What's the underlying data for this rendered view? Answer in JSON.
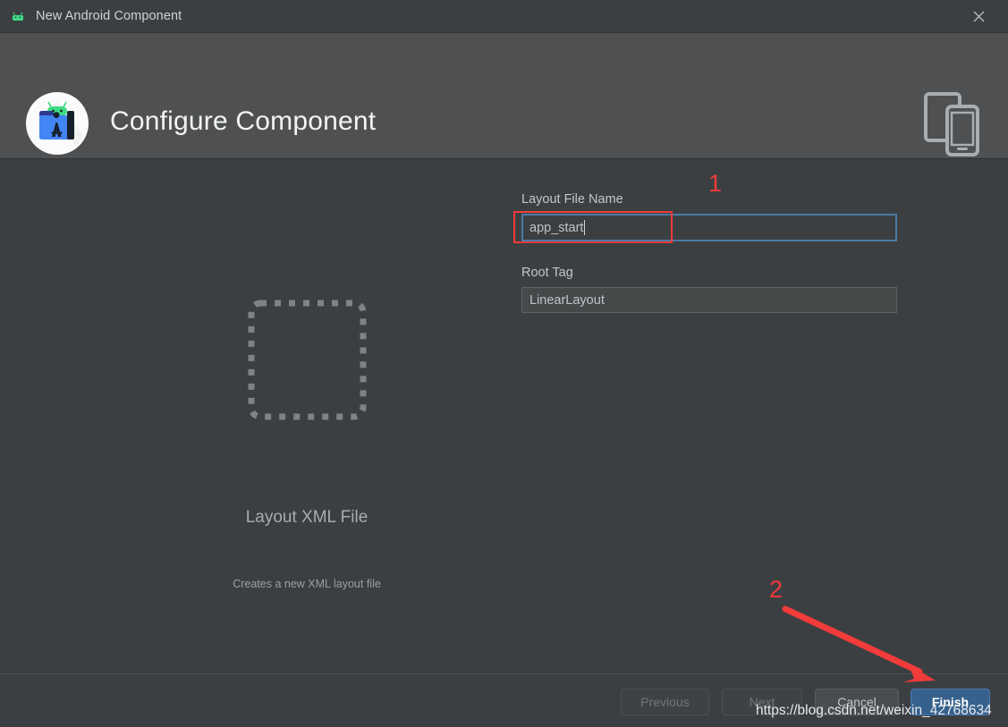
{
  "window": {
    "title": "New Android Component",
    "app_icon": "android-head-icon",
    "close_icon": "close-icon"
  },
  "header": {
    "title": "Configure Component",
    "logo_icon": "android-studio-logo-icon",
    "device_icon": "tablet-phone-icon"
  },
  "preview": {
    "icon": "dashed-square-icon",
    "title": "Layout XML File",
    "description": "Creates a new XML layout file"
  },
  "form": {
    "fields": [
      {
        "label": "Layout File Name",
        "value": "app_start",
        "placeholder": "",
        "focused": true
      },
      {
        "label": "Root Tag",
        "value": "LinearLayout",
        "placeholder": "",
        "focused": false
      }
    ]
  },
  "footer": {
    "buttons": [
      {
        "label": "Previous",
        "state": "disabled"
      },
      {
        "label": "Next",
        "state": "disabled"
      },
      {
        "label": "Cancel",
        "state": "enabled"
      },
      {
        "label": "Finish",
        "state": "primary"
      }
    ]
  },
  "annotations": {
    "marker_1": "1",
    "marker_2": "2",
    "highlight_color": "#ef3b3b"
  },
  "watermark": {
    "text": "https://blog.csdn.net/weixin_42768634"
  }
}
